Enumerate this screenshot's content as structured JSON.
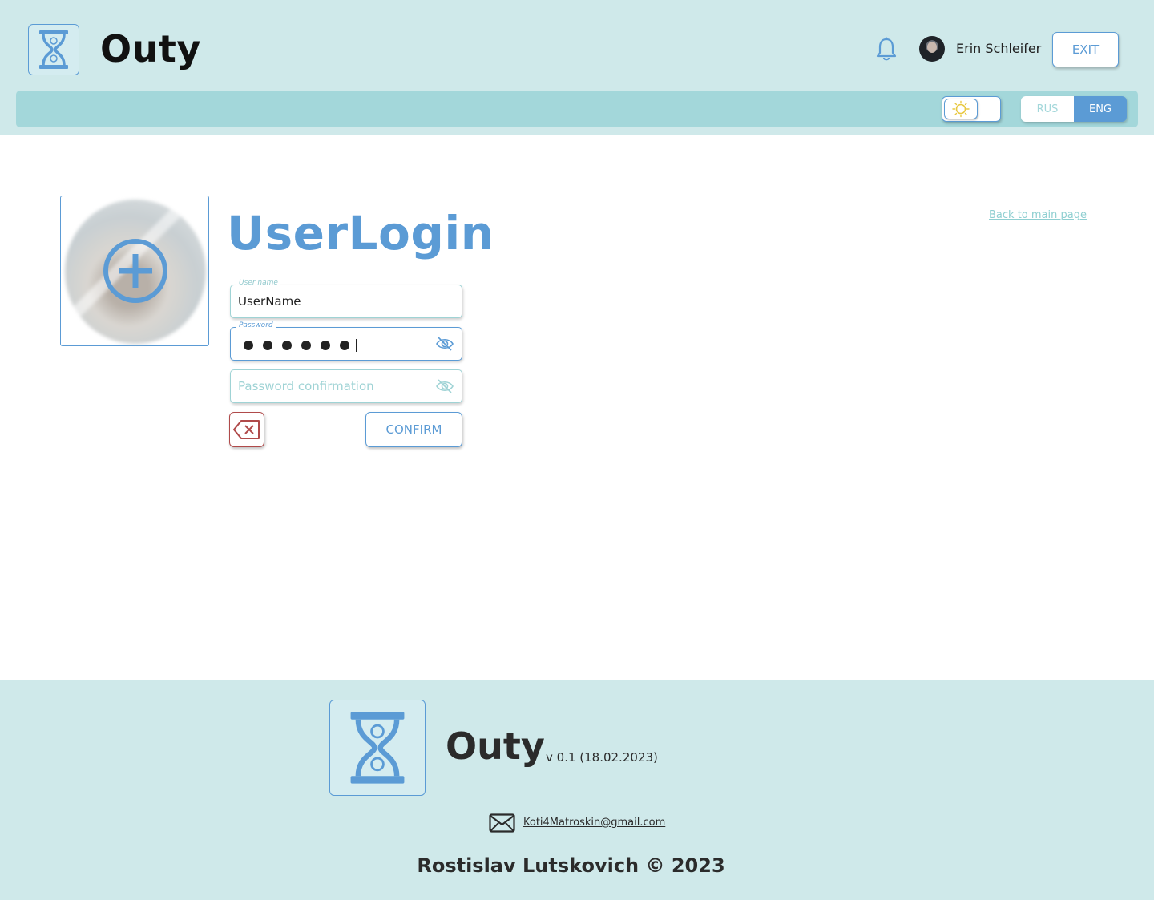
{
  "header": {
    "app_name": "Outy",
    "user_name": "Erin Schleifer",
    "exit_label": "EXIT"
  },
  "toolbar": {
    "theme": "light",
    "languages": [
      "RUS",
      "ENG"
    ],
    "active_language": "ENG"
  },
  "main": {
    "title": "UserLogin",
    "back_link": "Back to main page",
    "fields": {
      "username": {
        "label": "User name",
        "value": "UserName"
      },
      "password": {
        "label": "Password",
        "masked_length": 6
      },
      "password_confirmation": {
        "placeholder": "Password confirmation"
      }
    },
    "confirm_label": "CONFIRM"
  },
  "footer": {
    "app_name": "Outy",
    "version": "v 0.1 (18.02.2023)",
    "email": "Koti4Matroskin@gmail.com",
    "copyright": "Rostislav Lutskovich © 2023"
  },
  "colors": {
    "accent": "#5b9bd5",
    "header_bg": "#cfe9ea",
    "toolbar_bg": "#a3d7da",
    "danger": "#b04a4a"
  },
  "icons": [
    "hourglass-logo-icon",
    "bell-icon",
    "sun-icon",
    "plus-circle-icon",
    "eye-slash-icon",
    "backspace-x-icon",
    "mail-icon"
  ]
}
